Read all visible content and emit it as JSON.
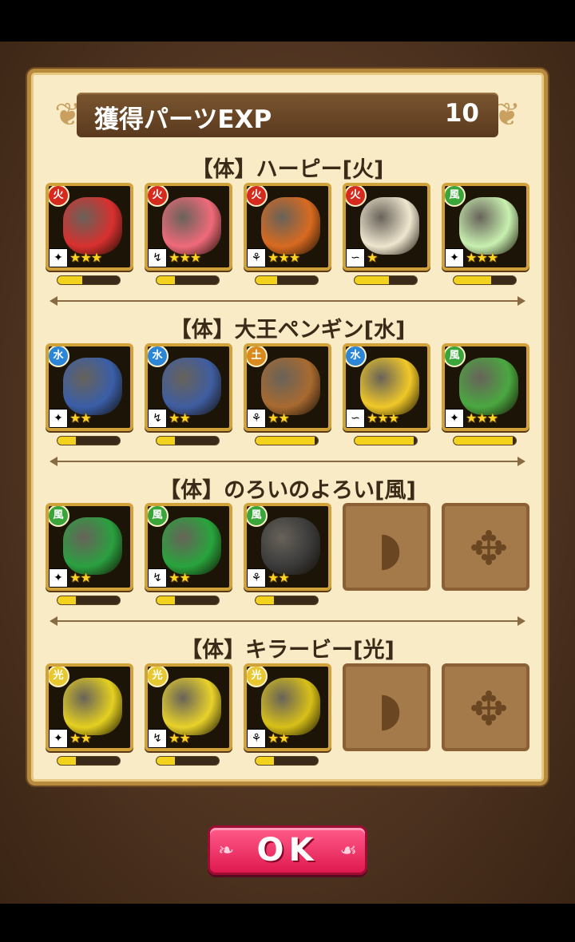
{
  "header": {
    "title": "獲得パーツEXP",
    "value": "10"
  },
  "groups": [
    {
      "label": "【体】ハーピー[火]",
      "slots": [
        {
          "empty": false,
          "element": "fire",
          "type_icon": "wing",
          "stars": 3,
          "exp": 0.4,
          "art": "#d8302f"
        },
        {
          "empty": false,
          "element": "fire",
          "type_icon": "arm",
          "stars": 3,
          "exp": 0.3,
          "art": "#f06a7a"
        },
        {
          "empty": false,
          "element": "fire",
          "type_icon": "leg",
          "stars": 3,
          "exp": 0.35,
          "art": "#d86a20"
        },
        {
          "empty": false,
          "element": "fire",
          "type_icon": "tail",
          "stars": 1,
          "exp": 0.55,
          "art": "#efe6cf"
        },
        {
          "empty": false,
          "element": "wood",
          "type_icon": "wing",
          "stars": 3,
          "exp": 0.6,
          "art": "#c8f0b0"
        }
      ]
    },
    {
      "label": "【体】大王ペンギン[水]",
      "slots": [
        {
          "empty": false,
          "element": "water",
          "type_icon": "wing",
          "stars": 2,
          "exp": 0.3,
          "art": "#3a5ea8"
        },
        {
          "empty": false,
          "element": "water",
          "type_icon": "arm",
          "stars": 2,
          "exp": 0.3,
          "art": "#3f5da0"
        },
        {
          "empty": false,
          "element": "earth",
          "type_icon": "leg",
          "stars": 2,
          "exp": 0.95,
          "art": "#a86a30"
        },
        {
          "empty": false,
          "element": "water",
          "type_icon": "tail",
          "stars": 3,
          "exp": 0.95,
          "art": "#f0c828"
        },
        {
          "empty": false,
          "element": "wood",
          "type_icon": "wing",
          "stars": 3,
          "exp": 0.95,
          "art": "#4aa840"
        }
      ]
    },
    {
      "label": "【体】のろいのよろい[風]",
      "slots": [
        {
          "empty": false,
          "element": "wood",
          "type_icon": "wing",
          "stars": 2,
          "exp": 0.3,
          "art": "#2aa040"
        },
        {
          "empty": false,
          "element": "wood",
          "type_icon": "arm",
          "stars": 2,
          "exp": 0.3,
          "art": "#28a43c"
        },
        {
          "empty": false,
          "element": "wood",
          "type_icon": "leg",
          "stars": 2,
          "exp": 0.3,
          "art": "#3a3a3a"
        },
        {
          "empty": true,
          "placeholder": "tail"
        },
        {
          "empty": true,
          "placeholder": "wing"
        }
      ]
    },
    {
      "label": "【体】キラービー[光]",
      "slots": [
        {
          "empty": false,
          "element": "light",
          "type_icon": "wing",
          "stars": 2,
          "exp": 0.3,
          "art": "#e4d020"
        },
        {
          "empty": false,
          "element": "light",
          "type_icon": "arm",
          "stars": 2,
          "exp": 0.3,
          "art": "#e8d22a"
        },
        {
          "empty": false,
          "element": "light",
          "type_icon": "leg",
          "stars": 2,
          "exp": 0.3,
          "art": "#d8c018"
        },
        {
          "empty": true,
          "placeholder": "tail"
        },
        {
          "empty": true,
          "placeholder": "wing"
        }
      ]
    }
  ],
  "ok_button": {
    "label": "OK"
  },
  "colors": {
    "fire": "#d62a1e",
    "water": "#2c86d8",
    "wood": "#3aa53a",
    "light": "#e8c830",
    "earth": "#d88a1e"
  }
}
